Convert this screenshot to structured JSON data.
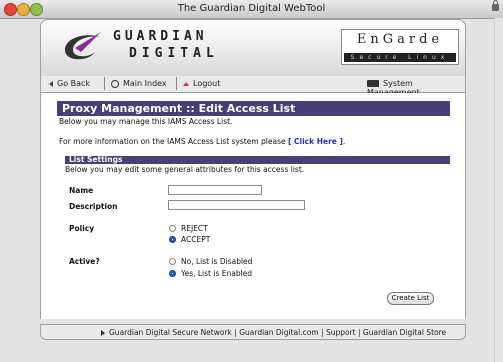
{
  "window": {
    "title": "The Guardian Digital WebTool"
  },
  "brand": {
    "top": "GUARDIAN",
    "bottom": "DIGITAL",
    "product_title": "EnGarde",
    "product_sub": "Secure Linux"
  },
  "nav": {
    "go_back": "Go Back",
    "main_index": "Main Index",
    "logout": "Logout",
    "system_management": "System Management"
  },
  "page": {
    "title": "Proxy Management :: Edit Access List",
    "intro": "Below you may manage this IAMS Access List.",
    "info_prefix": "For more information on the IAMS Access List system please",
    "info_link": "[ Click Here ]",
    "info_suffix": "."
  },
  "settings": {
    "title": "List Settings",
    "desc": "Below you may edit some general attributes for this access list.",
    "name_label": "Name",
    "name_value": "",
    "description_label": "Description",
    "description_value": "",
    "policy_label": "Policy",
    "policy_options": [
      "REJECT",
      "ACCEPT"
    ],
    "policy_selected": "ACCEPT",
    "active_label": "Active?",
    "active_options": [
      "No, List is Disabled",
      "Yes, List is Enabled"
    ],
    "active_selected": "Yes, List is Enabled",
    "create_button": "Create List"
  },
  "footer": {
    "links": [
      "Guardian Digital Secure Network",
      "Guardian Digital.com",
      "Support",
      "Guardian Digital Store"
    ],
    "separator": "|"
  },
  "colors": {
    "section_header": "#4a3e77",
    "link": "#2233bb",
    "radio_selected": "#2b5fb8"
  }
}
